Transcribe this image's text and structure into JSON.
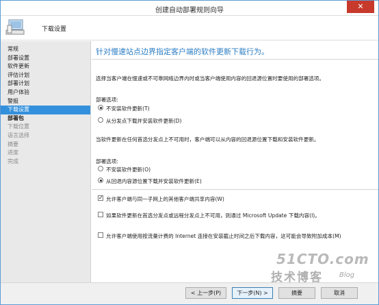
{
  "window": {
    "title": "创建自动部署规则向导",
    "close": "✕"
  },
  "header": {
    "title": "下载设置"
  },
  "sidebar": {
    "items": [
      {
        "label": "常规",
        "state": "normal"
      },
      {
        "label": "部署设置",
        "state": "normal"
      },
      {
        "label": "软件更新",
        "state": "normal"
      },
      {
        "label": "评估计划",
        "state": "normal"
      },
      {
        "label": "部署计划",
        "state": "normal"
      },
      {
        "label": "用户体验",
        "state": "normal"
      },
      {
        "label": "警报",
        "state": "normal"
      },
      {
        "label": "下载设置",
        "state": "selected"
      },
      {
        "label": "部署包",
        "state": "bold"
      },
      {
        "label": "下载位置",
        "state": "disabled"
      },
      {
        "label": "语言选择",
        "state": "disabled"
      },
      {
        "label": "摘要",
        "state": "disabled"
      },
      {
        "label": "进度",
        "state": "disabled"
      },
      {
        "label": "完成",
        "state": "disabled"
      }
    ]
  },
  "main": {
    "heading": "针对慢速站点边界指定客户端的软件更新下载行为。",
    "section1": {
      "description": "选择当客户端在慢速或不可靠网络边界内时或当客户端使用内容的回退源位置时要使用的部署选项。",
      "group_label": "部署选项:",
      "options": [
        {
          "label": "不安装软件更新(T)",
          "selected": true
        },
        {
          "label": "从分发点下载并安装软件更新(D)",
          "selected": false
        }
      ]
    },
    "section2": {
      "description": "当软件更新在任何首选分发点上不可用时，客户端可以从内容的回退源位置下载和安装软件更新。",
      "group_label": "部署选项:",
      "options": [
        {
          "label": "不安装软件更新(O)",
          "selected": false
        },
        {
          "label": "从回退内容源位置下载并安装软件更新(E)",
          "selected": true
        }
      ]
    },
    "checkboxes": [
      {
        "label": "允许客户端与同一子网上的其他客户端共享内容(W)",
        "checked": true
      },
      {
        "label": "如果软件更新在首选分发点或远程分发点上不可用，则通过 Microsoft Update 下载内容(I)。",
        "checked": false
      },
      {
        "label": "允许客户端使用按流量计费的 Internet 连接在安装截止时间之后下载内容，这可能会导致附加成本(M)",
        "checked": false
      }
    ]
  },
  "footer": {
    "prev": "< 上一步(P)",
    "next": "下一步(N) >",
    "summary": "摘要",
    "cancel": "取消"
  },
  "watermark": {
    "line1": "51CTO.com",
    "line2": "技术博客",
    "line3": "Blog"
  }
}
